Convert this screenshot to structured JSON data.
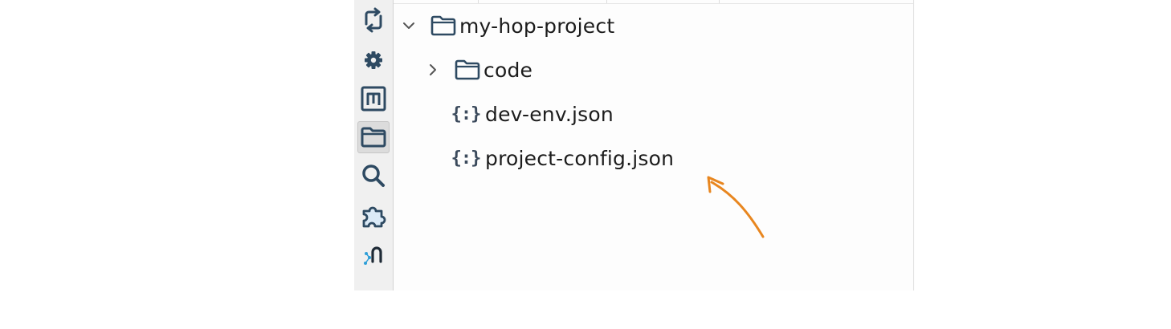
{
  "toolbar": {
    "buttons": [
      {
        "icon": "refresh-icon",
        "active": false
      },
      {
        "icon": "gear-icon",
        "active": false
      },
      {
        "icon": "metadata-m-icon",
        "active": false
      },
      {
        "icon": "folder-icon",
        "active": true
      },
      {
        "icon": "search-icon",
        "active": false
      },
      {
        "icon": "puzzle-piece-icon",
        "active": false
      },
      {
        "icon": "git-icon",
        "active": false
      }
    ]
  },
  "explorer": {
    "tree": [
      {
        "label": "my-hop-project",
        "type": "folder",
        "expanded": true,
        "depth": 0
      },
      {
        "label": "code",
        "type": "folder",
        "expanded": false,
        "depth": 1
      },
      {
        "label": "dev-env.json",
        "type": "json-file",
        "depth": 1
      },
      {
        "label": "project-config.json",
        "type": "json-file",
        "depth": 1
      }
    ],
    "json_glyph": "{:}"
  },
  "annotation": {
    "arrow_color": "#e8861f",
    "points_to": "project-config.json"
  },
  "colors": {
    "icon_dark": "#2e4a62",
    "icon_blue": "#2f9fd8",
    "text": "#1c1c1c",
    "toolbar_bg": "#f0f0f0"
  }
}
